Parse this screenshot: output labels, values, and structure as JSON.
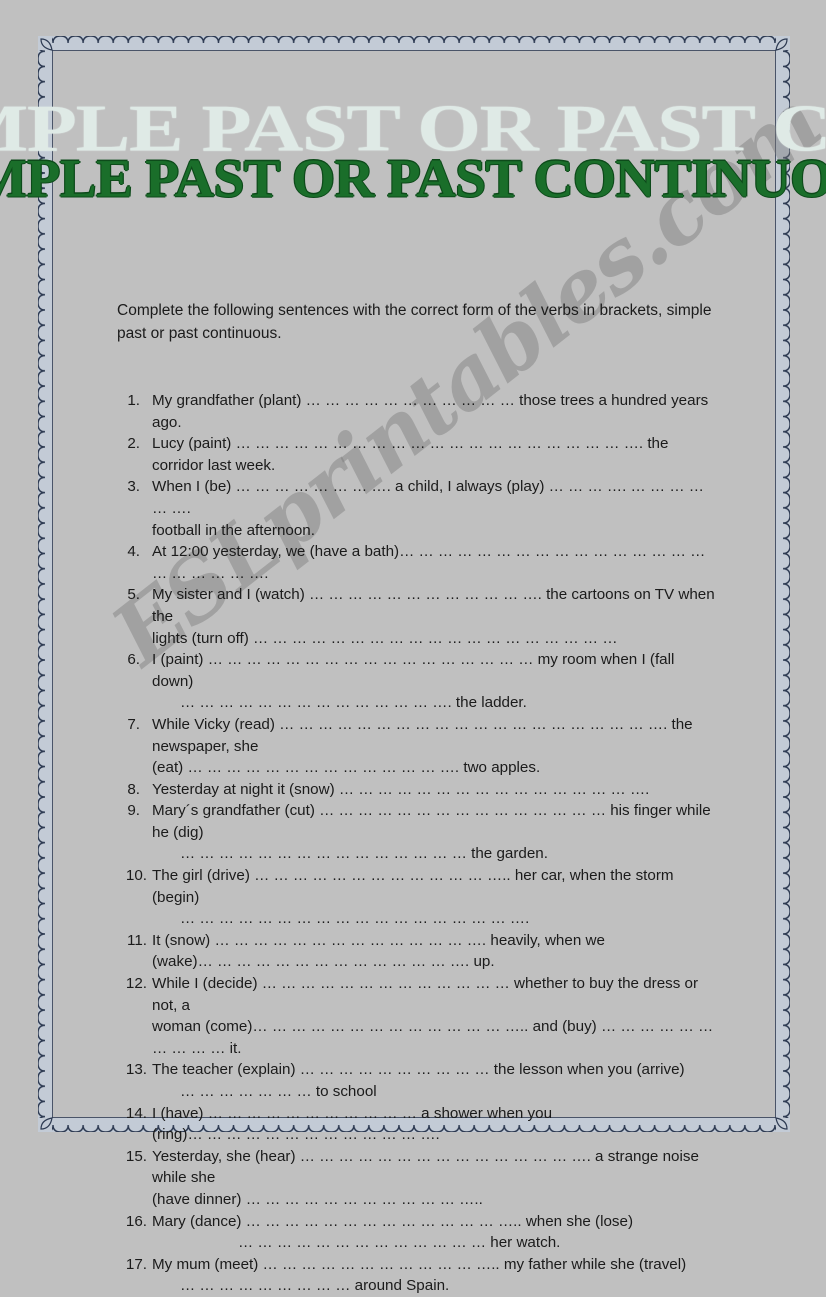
{
  "page": {
    "background_color": "#c0c0c0",
    "frame_line_color": "#2d3a52",
    "frame_band_color": "#c3cbd6"
  },
  "watermark": {
    "text": "ESLprintables.com",
    "color": "#787878"
  },
  "title": {
    "ghost_text": "SIMPLE PAST  OR  PAST CONTINUOUS",
    "ghost_color": "#dfeae6",
    "main_text": "SIMPLE PAST  OR  PAST CONTINUOUS",
    "main_color": "#1a6e2a"
  },
  "instructions": {
    "text": "Complete the following sentences with the correct form of the verbs in brackets, simple past or past continuous."
  },
  "exercises": [
    {
      "number": "1.",
      "wide_gap": true,
      "lines": [
        {
          "text": "My grandfather (plant) … … … … … … … … … … … those trees a hundred years",
          "indent": "none"
        },
        {
          "text": "ago.",
          "indent": "none"
        }
      ]
    },
    {
      "number": "2.",
      "wide_gap": true,
      "lines": [
        {
          "text": "Lucy (paint) … … … … … … … … … … … … … … … … … … … … …. the corridor last week.",
          "indent": "none"
        }
      ]
    },
    {
      "number": "3.",
      "wide_gap": true,
      "lines": [
        {
          "text": "When I (be) … … … … … … … …. a child, I always (play) … … … …. … … … … … ….",
          "indent": "none"
        },
        {
          "text": "football in the afternoon.",
          "indent": "none"
        }
      ]
    },
    {
      "number": "4.",
      "wide_gap": true,
      "lines": [
        {
          "text": "At 12:00 yesterday, we (have a bath)… … … … … … … … … … … … … … … … … … … … … ….",
          "indent": "none"
        }
      ]
    },
    {
      "number": "5.",
      "wide_gap": true,
      "lines": [
        {
          "text": "My sister and I (watch) … … … … … … … … … … … …. the cartoons on TV when the",
          "indent": "none"
        },
        {
          "text": "lights (turn off)  … … … … … … … … … … … … … … … … … … …",
          "indent": "none"
        }
      ]
    },
    {
      "number": "6.",
      "wide_gap": true,
      "lines": [
        {
          "text": "I (paint) … … … … … … … … … … … … … … … … … my room when I (fall down)",
          "indent": "none"
        },
        {
          "text": "… … … … … … … … … … … … … …. the ladder.",
          "indent": "dots"
        }
      ]
    },
    {
      "number": "7.",
      "wide_gap": true,
      "lines": [
        {
          "text": "While Vicky (read) … … … … … … … … … … … … … … … … … … … …. the newspaper, she",
          "indent": "none"
        },
        {
          "text": "(eat) … … … … … … … … … … … … … …. two apples.",
          "indent": "none"
        }
      ]
    },
    {
      "number": "8.",
      "wide_gap": true,
      "lines": [
        {
          "text": "Yesterday at night it (snow) … … … … … … … … … … … … … … … ….",
          "indent": "none"
        }
      ]
    },
    {
      "number": "9.",
      "wide_gap": true,
      "lines": [
        {
          "text": "Mary´s grandfather (cut) … … … … … … … … … … … … … … … his finger while he (dig)",
          "indent": "none"
        },
        {
          "text": "… … … … … … … … … … … … … … … the garden.",
          "indent": "dots"
        }
      ]
    },
    {
      "number": "10.",
      "wide_gap": false,
      "lines": [
        {
          "text": "The girl (drive) … … … … … … … … … … … … ….. her car, when the storm (begin)",
          "indent": "none"
        },
        {
          "text": "… … … … …          … … … … … … … … … … … … ….",
          "indent": "dots"
        }
      ]
    },
    {
      "number": "11.",
      "wide_gap": false,
      "lines": [
        {
          "text": "It (snow) … … … … … … … … … … … … … …. heavily, when we",
          "indent": "none"
        },
        {
          "text": "(wake)… … … … … … … … … … … … … …. up.",
          "indent": "none"
        }
      ]
    },
    {
      "number": "12.",
      "wide_gap": false,
      "lines": [
        {
          "text": "While I (decide) … … … … … … … … … … … … … whether to buy the dress or not, a",
          "indent": "none"
        },
        {
          "text": "woman (come)… … … … … … … … … … … … … ….. and (buy) … … … … … … … … … …  it.",
          "indent": "none"
        }
      ]
    },
    {
      "number": "13.",
      "wide_gap": false,
      "lines": [
        {
          "text": "The teacher (explain) … … … … … … … … … …  the lesson when you (arrive)",
          "indent": "none"
        },
        {
          "text": "… … … … … … … to school",
          "indent": "dots"
        }
      ]
    },
    {
      "number": "14.",
      "wide_gap": false,
      "lines": [
        {
          "text": "I (have) … … … … … … … … … … … a shower when you",
          "indent": "none"
        },
        {
          "text": "(ring)… … … … … … … … … … … … ….",
          "indent": "none"
        }
      ]
    },
    {
      "number": "15.",
      "wide_gap": false,
      "lines": [
        {
          "text": "Yesterday, she (hear) … … … … … … … … … … … … … … …. a strange noise while she",
          "indent": "none"
        },
        {
          "text": "(have dinner) … … … … … … … … … … … …..",
          "indent": "none"
        }
      ]
    },
    {
      "number": "16.",
      "wide_gap": false,
      "lines": [
        {
          "text": "Mary (dance) … … … … … … … … … … … … … ….. when she (lose)",
          "indent": "none"
        },
        {
          "text": "… … … … … … … … … … … … … her watch.",
          "indent": "dots-wide"
        }
      ]
    },
    {
      "number": "17.",
      "wide_gap": false,
      "lines": [
        {
          "text": "My mum (meet) … … … … … … … … … … … ….. my father while she (travel)",
          "indent": "none"
        },
        {
          "text": "… … … … … … … … … around Spain.",
          "indent": "dots"
        }
      ]
    }
  ]
}
